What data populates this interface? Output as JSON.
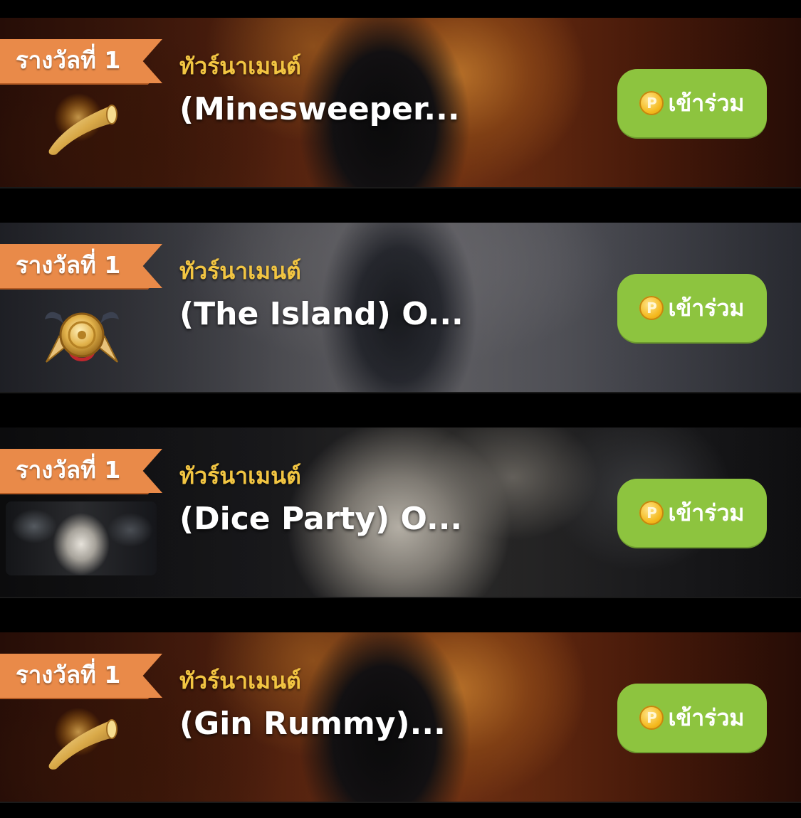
{
  "tournaments": [
    {
      "rank_label": "รางวัลที่ 1",
      "category": "ทัวร์นาเมนต์",
      "title": "(Minesweeper...",
      "button_label": "เข้าร่วม",
      "coin_symbol": "P",
      "prize_icon": "golden-horn-icon",
      "background": "fiery-dark-figure"
    },
    {
      "rank_label": "รางวัลที่ 1",
      "category": "ทัวร์นาเมนต์",
      "title": "(The Island) O...",
      "button_label": "เข้าร่วม",
      "coin_symbol": "P",
      "prize_icon": "gold-medal-icon",
      "background": "grey-wolf-beast"
    },
    {
      "rank_label": "รางวัลที่ 1",
      "category": "ทัวร์นาเมนต์",
      "title": "(Dice Party) O...",
      "button_label": "เข้าร่วม",
      "coin_symbol": "P",
      "prize_icon": "old-man-thumbnail",
      "background": "old-bearded-man"
    },
    {
      "rank_label": "รางวัลที่ 1",
      "category": "ทัวร์นาเมนต์",
      "title": "(Gin Rummy)...",
      "button_label": "เข้าร่วม",
      "coin_symbol": "P",
      "prize_icon": "golden-horn-icon",
      "background": "fiery-dark-figure"
    }
  ],
  "colors": {
    "ribbon": "#e98a49",
    "category_text": "#f2c542",
    "join_button": "#8dc43f",
    "coin": "#f4b81c"
  }
}
